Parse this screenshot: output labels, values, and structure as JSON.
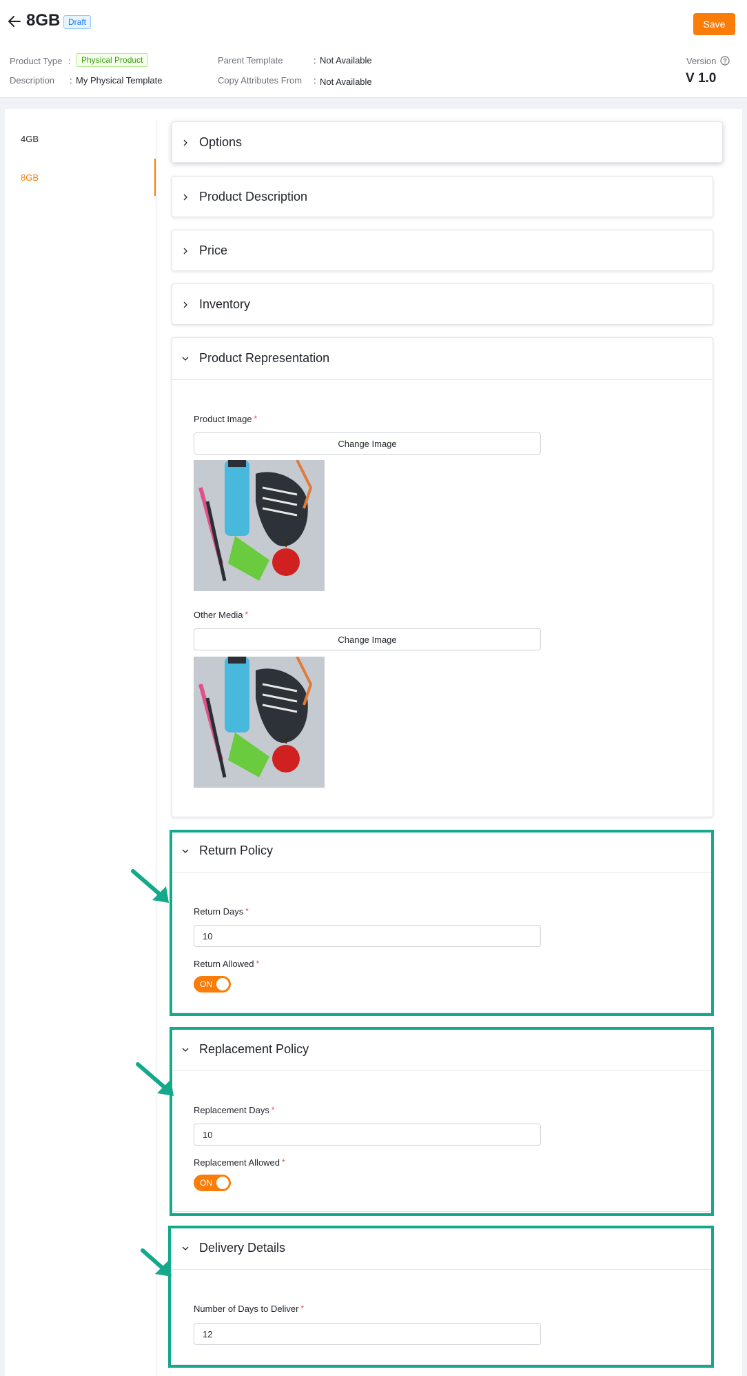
{
  "header": {
    "title": "8GB",
    "status_badge": "Draft",
    "save_label": "Save",
    "product_type_label": "Product Type",
    "product_type_value": "Physical Product",
    "description_label": "Description",
    "description_value": "My Physical Template",
    "parent_template_label": "Parent Template",
    "parent_template_value": "Not Available",
    "copy_attributes_label": "Copy Attributes From",
    "copy_attributes_value": "Not Available",
    "version_label": "Version",
    "version_value": "V 1.0"
  },
  "sidebar": {
    "items": [
      {
        "label": "4GB",
        "active": false
      },
      {
        "label": "8GB",
        "active": true
      }
    ]
  },
  "panels": {
    "options": {
      "title": "Options",
      "expanded": false
    },
    "product_description": {
      "title": "Product Description",
      "expanded": false
    },
    "price": {
      "title": "Price",
      "expanded": false
    },
    "inventory": {
      "title": "Inventory",
      "expanded": false
    },
    "product_representation": {
      "title": "Product Representation",
      "expanded": true,
      "product_image_label": "Product Image",
      "product_image_button": "Change Image",
      "other_media_label": "Other Media",
      "other_media_button": "Change Image"
    },
    "return_policy": {
      "title": "Return Policy",
      "expanded": true,
      "return_days_label": "Return Days",
      "return_days_value": "10",
      "return_allowed_label": "Return Allowed",
      "return_allowed_toggle": "ON"
    },
    "replacement_policy": {
      "title": "Replacement Policy",
      "expanded": true,
      "replacement_days_label": "Replacement Days",
      "replacement_days_value": "10",
      "replacement_allowed_label": "Replacement Allowed",
      "replacement_allowed_toggle": "ON"
    },
    "delivery_details": {
      "title": "Delivery Details",
      "expanded": true,
      "days_to_deliver_label": "Number of Days to Deliver",
      "days_to_deliver_value": "12"
    }
  },
  "required_mark": "*",
  "colors": {
    "accent": "#fa7d09",
    "highlight": "#14a98a",
    "required": "#e34d59"
  }
}
